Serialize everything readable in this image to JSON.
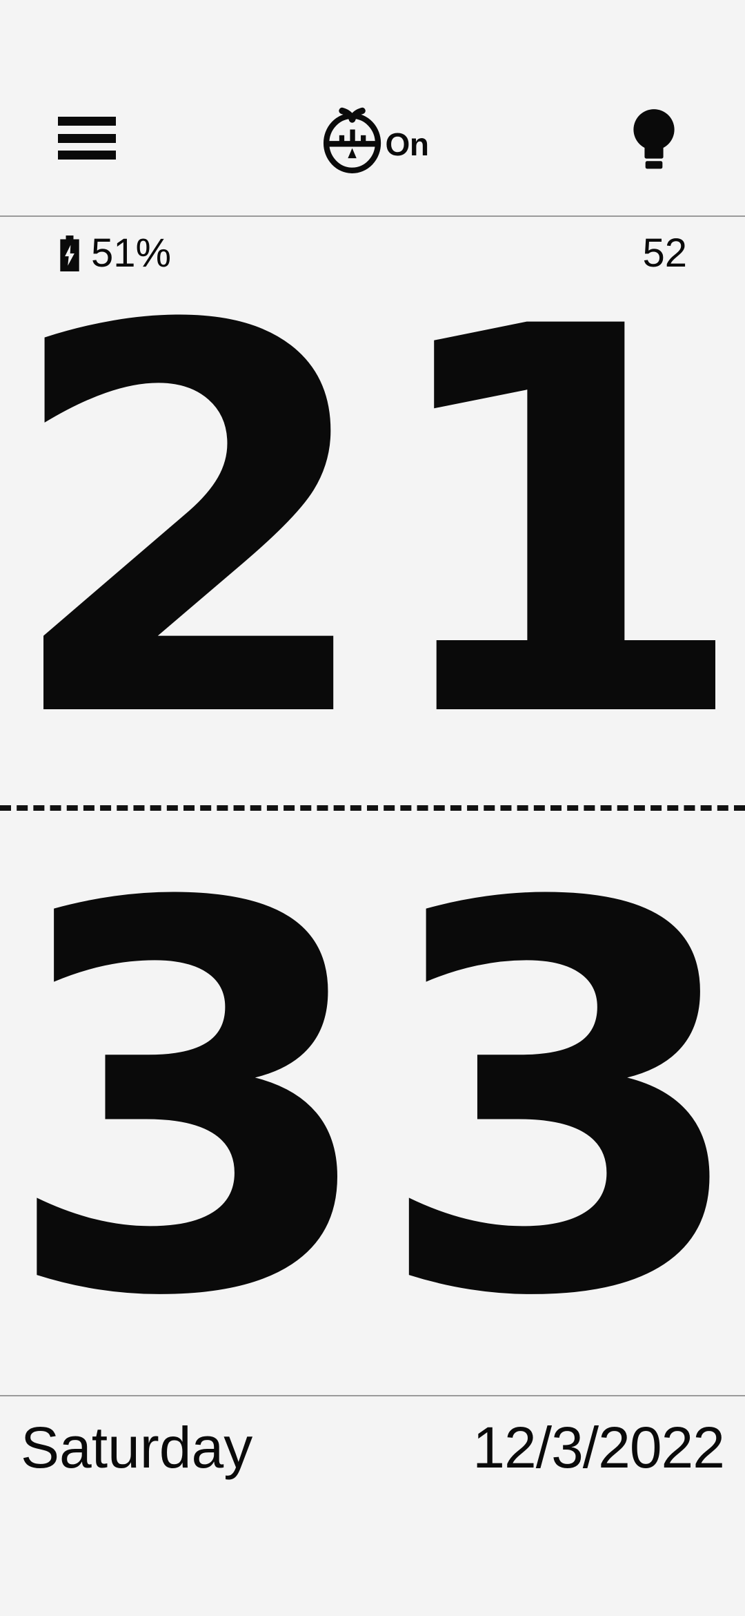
{
  "app": {
    "background_color": "#f4f4f4",
    "foreground_color": "#0a0a0a",
    "divider_color": "#9a9a9a"
  },
  "header": {
    "menu_icon": "hamburger-menu-icon",
    "pomodoro_icon": "tomato-timer-icon",
    "pomodoro_state_label": "On",
    "bulb_icon": "lightbulb-icon"
  },
  "status": {
    "battery_icon": "battery-charging-icon",
    "battery_label": "51%",
    "week_number": "52"
  },
  "clock": {
    "hours": "21",
    "minutes": "33",
    "separator": "dashed"
  },
  "footer": {
    "weekday": "Saturday",
    "date": "12/3/2022"
  }
}
